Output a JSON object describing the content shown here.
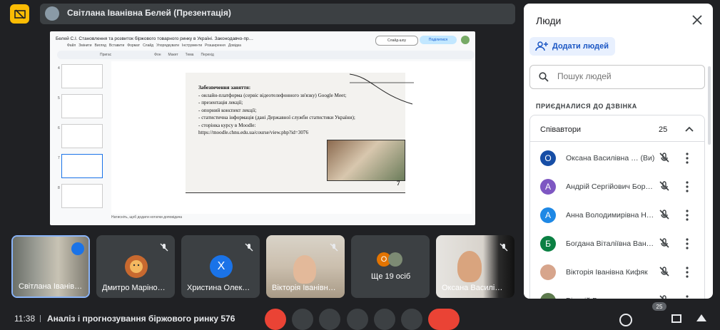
{
  "presenter": {
    "title": "Світлана Іванівна Белей (Презентація)"
  },
  "presentation": {
    "doc_title": "Белей С.І. Становлення та розвиток біржового товарного ринку в Україні. Законодавчо-пр…",
    "menu_items": [
      "Файл",
      "Змінити",
      "Вигляд",
      "Вставити",
      "Формат",
      "Слайд",
      "Упорядкувати",
      "Інструменти",
      "Розширення",
      "Довідка"
    ],
    "toolbar_items": [
      "Пригас",
      "Фон",
      "Макет",
      "Тема",
      "Перехід"
    ],
    "slideshow_label": "Слайд-шоу",
    "share_label": "Поділитися",
    "thumb_numbers": [
      "4",
      "5",
      "6",
      "7",
      "8"
    ],
    "slide": {
      "heading": "Забезпечення заняття:",
      "lines": [
        "- онлайн-платформа (сервіс відеотелефонного зв'язку) Google Meet;",
        "- презентація лекції;",
        "- опорний конспект лекції;",
        "- статистична інформація (дані Державної служби статистики України);",
        "- сторінка курсу в Moodle: https://moodle.chnu.edu.ua/course/view.php?id=3076"
      ],
      "number": "7"
    },
    "notes_placeholder": "Натисніть, щоб додати нотатки доповідача"
  },
  "tiles": [
    {
      "name": "Світлана Іванів…",
      "kind": "video"
    },
    {
      "name": "Дмитро Маріно…",
      "kind": "avatar-image"
    },
    {
      "name": "Христина Олек…",
      "kind": "avatar",
      "initial": "Х",
      "color": "#1a73e8"
    },
    {
      "name": "Вікторія Іванівн…",
      "kind": "video"
    },
    {
      "name": "Ще 19 осіб",
      "kind": "more"
    },
    {
      "name": "Оксана Василі…",
      "kind": "video"
    }
  ],
  "bottom": {
    "time": "11:38",
    "meeting": "Аналіз і прогнозування біржового ринку 576",
    "participants_badge": "25"
  },
  "panel": {
    "title": "Люди",
    "add_people": "Додати людей",
    "search_placeholder": "Пошук людей",
    "joined_label": "ПРИЄДНАЛИСЯ ДО ДЗВІНКА",
    "group_label": "Співавтори",
    "group_count": "25",
    "people": [
      {
        "name": "Оксана Василівна … (Ви)",
        "initial": "О",
        "color": "#174ea6"
      },
      {
        "name": "Андрій Сергійович Бор…",
        "initial": "А",
        "color": "#7e57c2"
      },
      {
        "name": "Анна Володимирівна Н…",
        "initial": "А",
        "color": "#1e88e5"
      },
      {
        "name": "Богдана Віталіївна Ван…",
        "initial": "Б",
        "color": "#0b8043"
      },
      {
        "name": "Вікторія Іванівна Кифяк",
        "initial": "",
        "color": "#d7a58c"
      },
      {
        "name": "Віталій Володимирович…",
        "initial": "",
        "color": "#5d7a4e"
      }
    ]
  },
  "colors": {
    "background": "#202124",
    "accent": "#fbbc04",
    "end_call": "#ea4335",
    "panel_link": "#1a56c4"
  }
}
